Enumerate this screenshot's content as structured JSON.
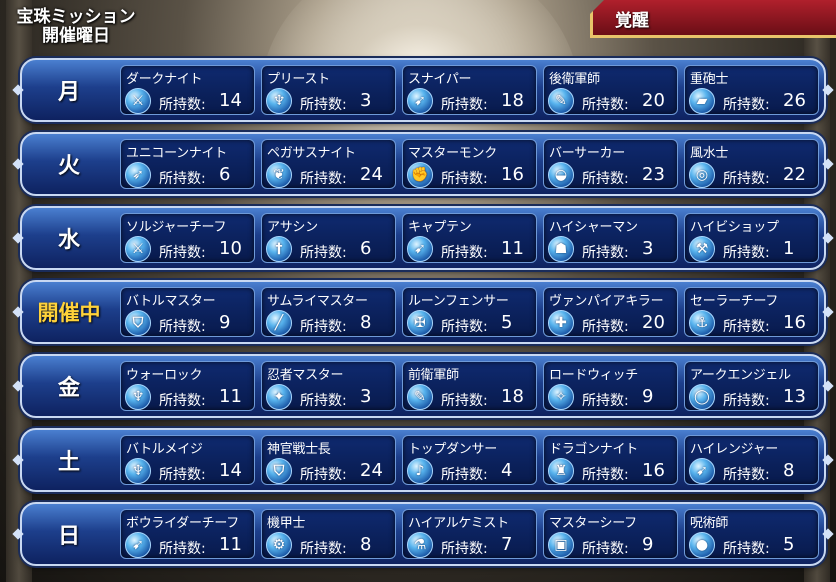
{
  "header": {
    "title_line1": "宝珠ミッション",
    "title_line2": "開催曜日",
    "tab_label": "覚醒"
  },
  "count_label": "所持数:",
  "active_color": "#ffd23a",
  "rows": [
    {
      "day": "月",
      "active": false,
      "items": [
        {
          "name": "ダークナイト",
          "count": "14",
          "icon": "sword-icon"
        },
        {
          "name": "プリースト",
          "count": "3",
          "icon": "staff-icon"
        },
        {
          "name": "スナイパー",
          "count": "18",
          "icon": "bow-icon"
        },
        {
          "name": "後衛軍師",
          "count": "20",
          "icon": "book-icon"
        },
        {
          "name": "重砲士",
          "count": "26",
          "icon": "cannon-icon"
        }
      ]
    },
    {
      "day": "火",
      "active": false,
      "items": [
        {
          "name": "ユニコーンナイト",
          "count": "6",
          "icon": "lance-icon"
        },
        {
          "name": "ペガサスナイト",
          "count": "24",
          "icon": "wing-icon"
        },
        {
          "name": "マスターモンク",
          "count": "16",
          "icon": "fist-icon"
        },
        {
          "name": "バーサーカー",
          "count": "23",
          "icon": "helmet-icon"
        },
        {
          "name": "風水士",
          "count": "22",
          "icon": "ring-icon"
        }
      ]
    },
    {
      "day": "水",
      "active": false,
      "items": [
        {
          "name": "ソルジャーチーフ",
          "count": "10",
          "icon": "sword-icon"
        },
        {
          "name": "アサシン",
          "count": "6",
          "icon": "dagger-icon"
        },
        {
          "name": "キャプテン",
          "count": "11",
          "icon": "bow-icon"
        },
        {
          "name": "ハイシャーマン",
          "count": "3",
          "icon": "mask-icon"
        },
        {
          "name": "ハイビショップ",
          "count": "1",
          "icon": "hammer-icon"
        }
      ]
    },
    {
      "day": "開催中",
      "active": true,
      "items": [
        {
          "name": "バトルマスター",
          "count": "9",
          "icon": "shield-icon"
        },
        {
          "name": "サムライマスター",
          "count": "8",
          "icon": "katana-icon"
        },
        {
          "name": "ルーンフェンサー",
          "count": "5",
          "icon": "rune-sword-icon"
        },
        {
          "name": "ヴァンパイアキラー",
          "count": "20",
          "icon": "cross-icon"
        },
        {
          "name": "セーラーチーフ",
          "count": "16",
          "icon": "anchor-icon"
        }
      ]
    },
    {
      "day": "金",
      "active": false,
      "items": [
        {
          "name": "ウォーロック",
          "count": "11",
          "icon": "staff-icon"
        },
        {
          "name": "忍者マスター",
          "count": "3",
          "icon": "shuriken-icon"
        },
        {
          "name": "前衛軍師",
          "count": "18",
          "icon": "book-icon"
        },
        {
          "name": "ロードウィッチ",
          "count": "9",
          "icon": "wand-icon"
        },
        {
          "name": "アークエンジェル",
          "count": "13",
          "icon": "halo-icon"
        }
      ]
    },
    {
      "day": "土",
      "active": false,
      "items": [
        {
          "name": "バトルメイジ",
          "count": "14",
          "icon": "staff-icon"
        },
        {
          "name": "神官戦士長",
          "count": "24",
          "icon": "shield-icon"
        },
        {
          "name": "トップダンサー",
          "count": "4",
          "icon": "shoe-icon"
        },
        {
          "name": "ドラゴンナイト",
          "count": "16",
          "icon": "armor-icon"
        },
        {
          "name": "ハイレンジャー",
          "count": "8",
          "icon": "bow-icon"
        }
      ]
    },
    {
      "day": "日",
      "active": false,
      "items": [
        {
          "name": "ボウライダーチーフ",
          "count": "11",
          "icon": "bow-icon"
        },
        {
          "name": "機甲士",
          "count": "8",
          "icon": "robot-icon"
        },
        {
          "name": "ハイアルケミスト",
          "count": "7",
          "icon": "flask-icon"
        },
        {
          "name": "マスターシーフ",
          "count": "9",
          "icon": "chest-icon"
        },
        {
          "name": "呪術師",
          "count": "5",
          "icon": "orb-icon"
        }
      ]
    }
  ]
}
